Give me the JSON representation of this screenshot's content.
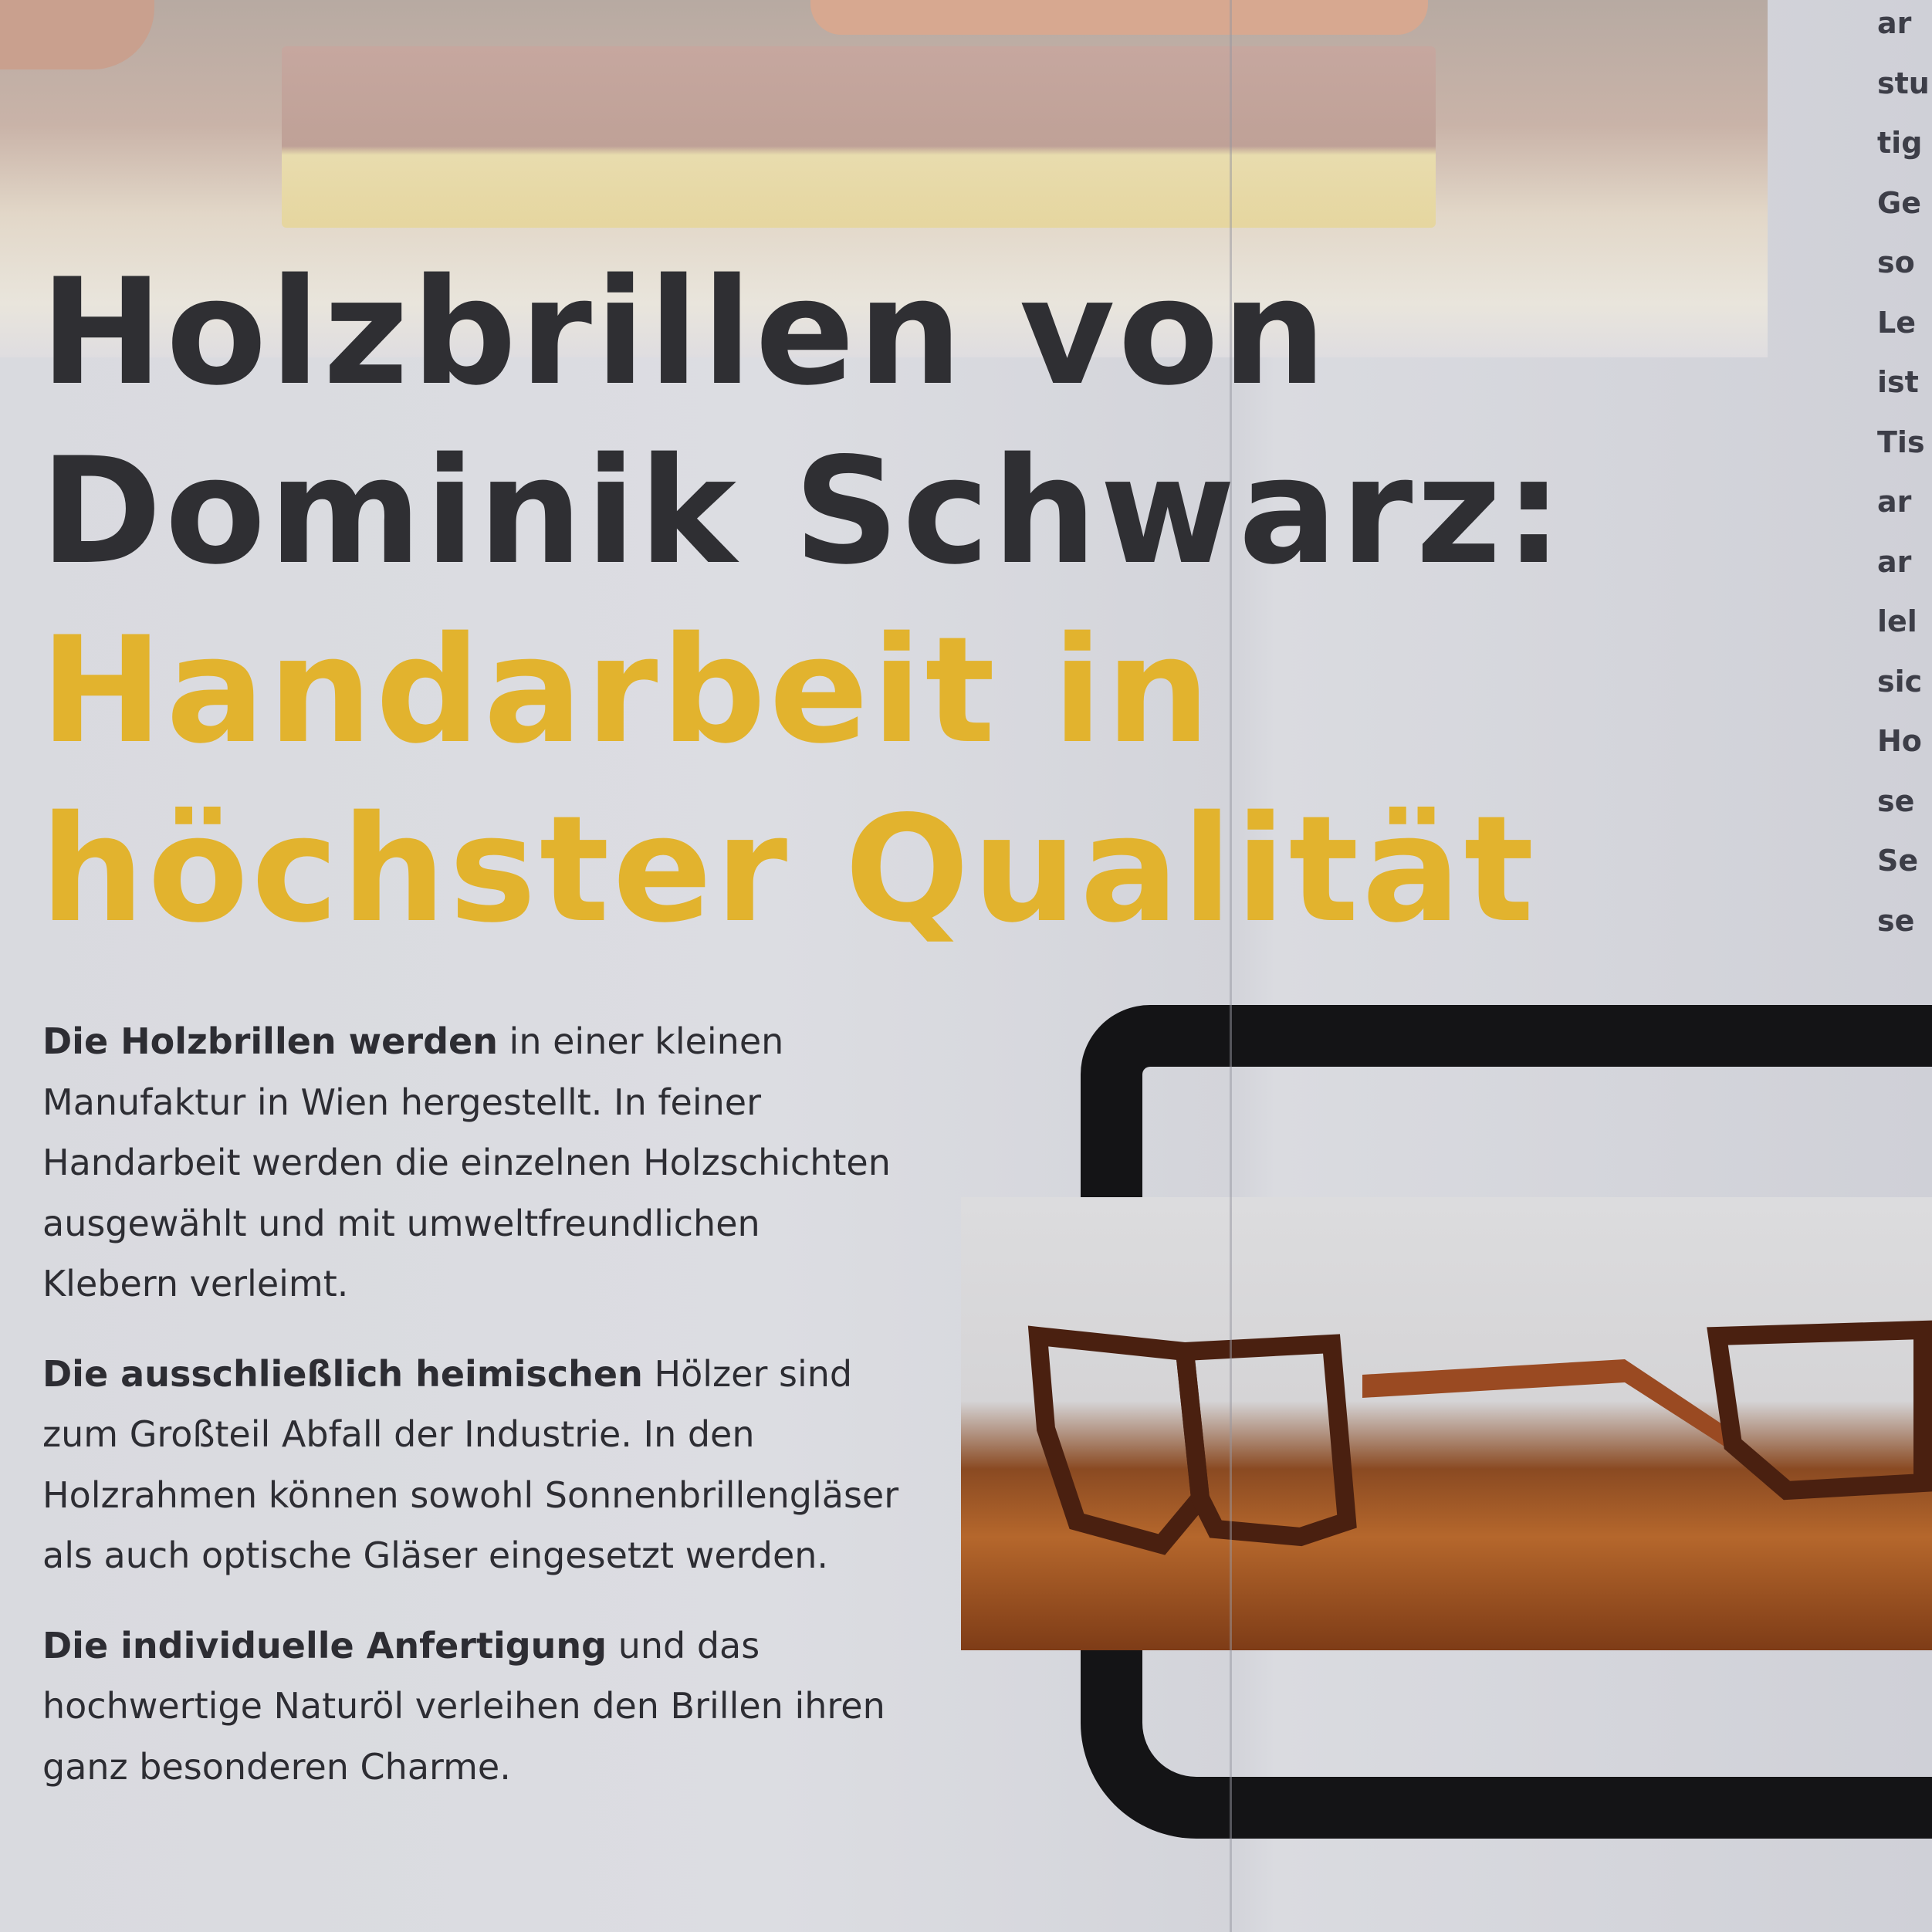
{
  "right_column_fragments": [
    "ar",
    "stu",
    "tig",
    "Ge",
    "so",
    "Le",
    "ist",
    "Tis",
    "ar",
    "ar",
    "lel",
    "sic",
    "Ho",
    "se",
    "Se",
    "se"
  ],
  "title": {
    "line1": "Holzbrillen von",
    "line2": "Dominik Schwarz:",
    "line3": "Handarbeit in",
    "line4": "höchster Qualität"
  },
  "colors": {
    "title_dark": "#2f2f33",
    "title_accent": "#e2b32e"
  },
  "paragraphs": [
    {
      "lead": "Die Holzbrillen werden",
      "text": " in einer kleinen Manufaktur in Wien hergestellt. In feiner Handarbeit werden die einzelnen Holzschichten ausgewählt und mit umweltfreundlichen Klebern verleimt."
    },
    {
      "lead": "Die ausschließlich heimischen",
      "text": " Hölzer sind zum Großteil Abfall der Industrie. In den Holzrahmen können sowohl Sonnenbrillengläser als auch optische Gläser eingesetzt werden."
    },
    {
      "lead": "Die individuelle Anfertigung",
      "text": " und das hochwertige Naturöl verleihen den Brillen ihren ganz besonderen Charme."
    }
  ]
}
